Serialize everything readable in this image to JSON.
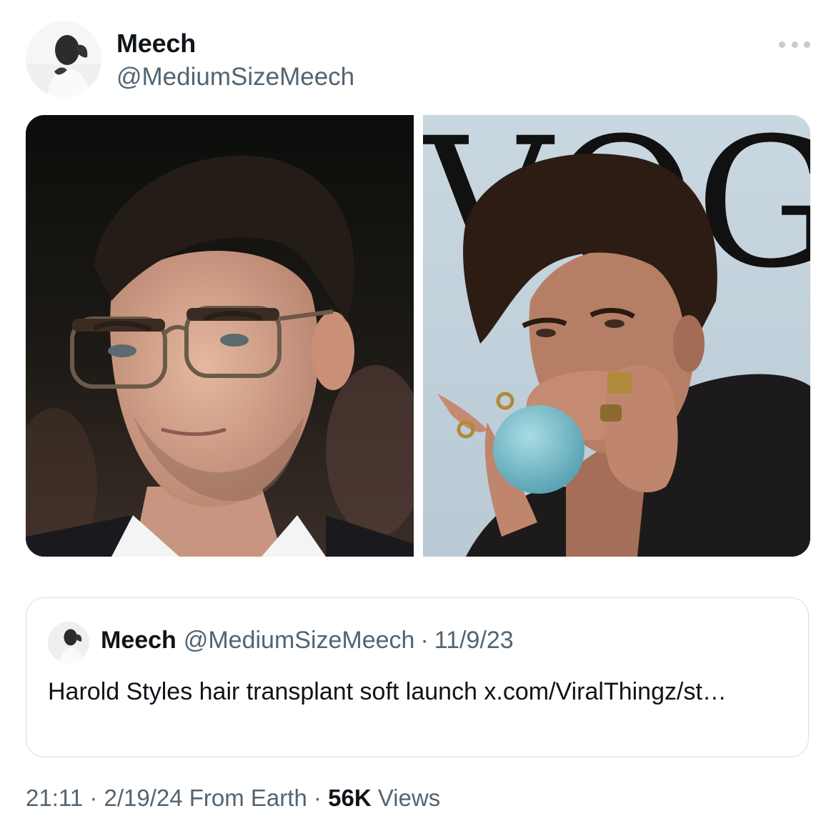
{
  "author": {
    "display_name": "Meech",
    "handle": "@MediumSizeMeech",
    "avatar_icon": "profile-photo-man"
  },
  "more_icon": "more-options-icon",
  "media": [
    {
      "description_icon": "photo-man-glasses"
    },
    {
      "description_icon": "photo-man-balloon-magazine",
      "magazine_letters": "VOGU"
    }
  ],
  "quote": {
    "display_name": "Meech",
    "handle": "@MediumSizeMeech",
    "separator": "·",
    "date": "11/9/23",
    "text": "Harold Styles hair transplant soft launch x.com/ViralThingz/st…"
  },
  "footer": {
    "time": "21:11",
    "sep1": "·",
    "date": "2/19/24",
    "source": "From Earth",
    "sep2": "·",
    "views_count": "56K",
    "views_label": "Views"
  },
  "colors": {
    "text_primary": "#0f1419",
    "text_secondary": "#536471",
    "border": "#d8dee3"
  }
}
